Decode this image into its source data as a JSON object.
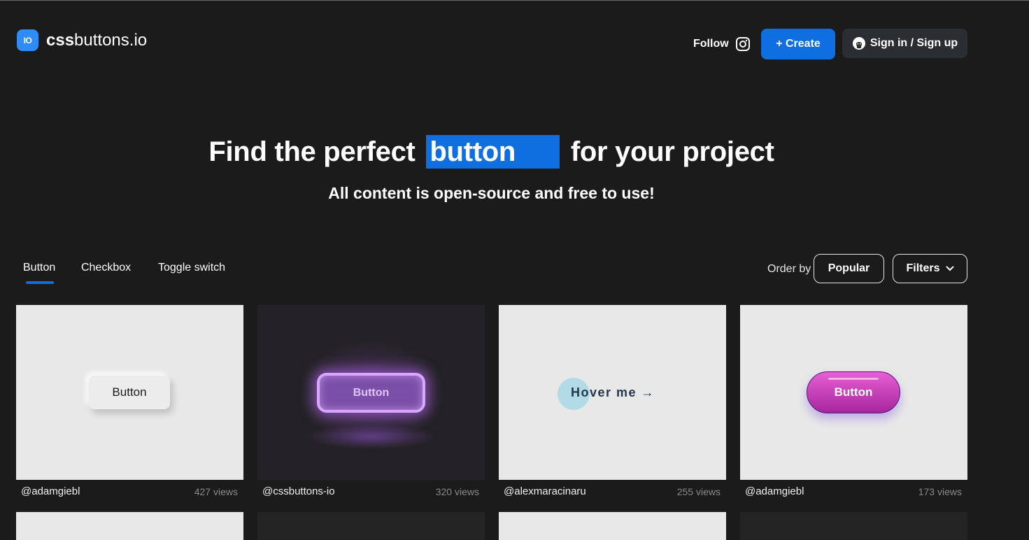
{
  "header": {
    "logo_mark": "IO",
    "logo_bold": "css",
    "logo_rest": "buttons.io",
    "follow_label": "Follow",
    "create_label": "+ Create",
    "signin_label": "Sign in / Sign up"
  },
  "hero": {
    "title_before": "Find the perfect",
    "title_highlight": "button",
    "title_after": "for your project",
    "subtitle": "All content is open-source and free to use!"
  },
  "tabs": [
    {
      "label": "Button",
      "active": true
    },
    {
      "label": "Checkbox",
      "active": false
    },
    {
      "label": "Toggle switch",
      "active": false
    }
  ],
  "ordering": {
    "order_by_label": "Order by",
    "order_value": "Popular",
    "filters_label": "Filters"
  },
  "cards": [
    {
      "user": "@adamgiebl",
      "views": "427 views",
      "demo_label": "Button"
    },
    {
      "user": "@cssbuttons-io",
      "views": "320 views",
      "demo_label": "Button"
    },
    {
      "user": "@alexmaracinaru",
      "views": "255 views",
      "demo_label": "Hover me →"
    },
    {
      "user": "@adamgiebl",
      "views": "173 views",
      "demo_label": "Button"
    }
  ],
  "colors": {
    "background": "#1b1b1b",
    "accent": "#0f6fe0",
    "card_light": "#e8e8e8"
  },
  "icons": [
    "instagram-icon",
    "github-icon",
    "chevron-down-icon"
  ]
}
